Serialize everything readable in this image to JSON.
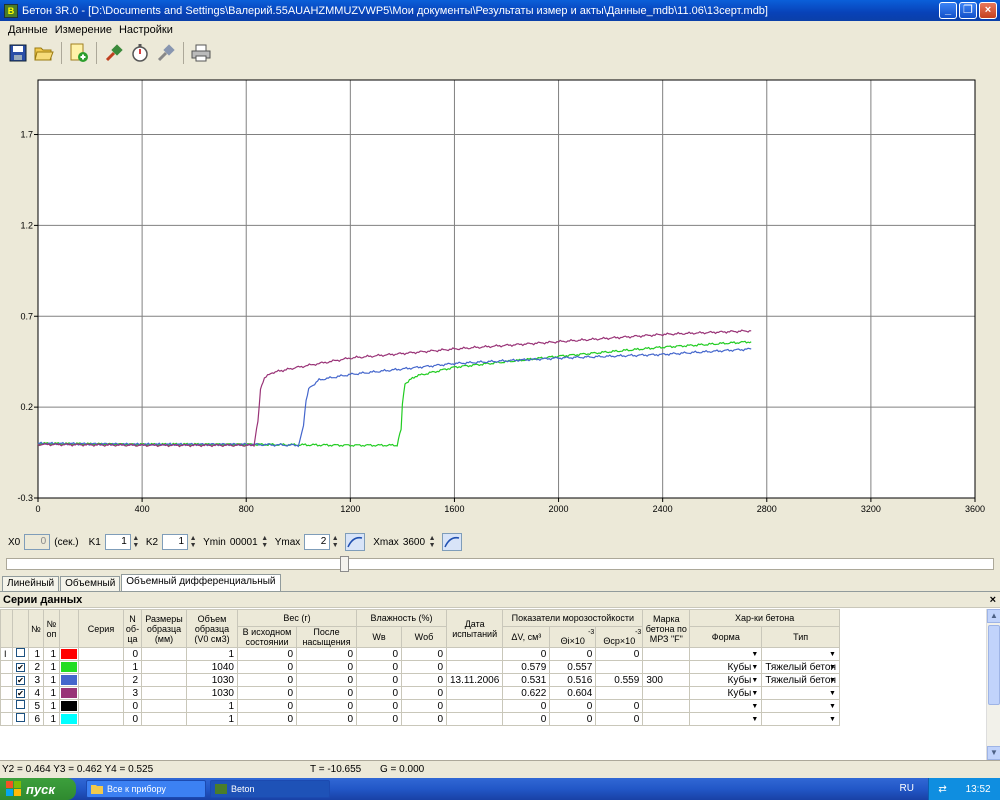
{
  "window": {
    "title": "Бетон 3R.0 - [D:\\Documents and Settings\\Валерий.55AUAHZMMUZVWP5\\Мои документы\\Результаты измер и акты\\Данные_mdb\\11.06\\13серт.mdb]",
    "app_icon_label": "B"
  },
  "menu": {
    "items": [
      "Данные",
      "Измерение",
      "Настройки"
    ]
  },
  "toolbar": {
    "icons": [
      "save-icon",
      "open-folder-icon",
      "add-document-icon",
      "connect-icon",
      "stopwatch-icon",
      "disconnect-icon",
      "print-icon"
    ]
  },
  "chart_data": {
    "type": "line",
    "title": "",
    "xlabel": "",
    "ylabel": "",
    "xlim": [
      0,
      3600
    ],
    "ylim": [
      -0.3,
      2.0
    ],
    "x_ticks": [
      "0",
      "400",
      "800",
      "1200",
      "1600",
      "2000",
      "2400",
      "2800",
      "3200",
      "3600"
    ],
    "y_ticks": [
      "-0.3",
      "0.2",
      "0.7",
      "1.2",
      "1.7"
    ],
    "grid": true,
    "series": [
      {
        "color": "#22cc22",
        "x": [
          0,
          400,
          800,
          1200,
          1380,
          1395,
          1400,
          1410,
          1450,
          1600,
          2000,
          2400,
          2740
        ],
        "y": [
          0.0,
          -0.005,
          -0.005,
          -0.01,
          -0.01,
          0.08,
          0.22,
          0.33,
          0.37,
          0.42,
          0.48,
          0.53,
          0.56
        ]
      },
      {
        "color": "#4466cc",
        "x": [
          0,
          400,
          800,
          1000,
          1020,
          1030,
          1040,
          1080,
          1200,
          1600,
          2000,
          2400,
          2740
        ],
        "y": [
          0.0,
          -0.005,
          -0.005,
          -0.01,
          0.1,
          0.24,
          0.3,
          0.35,
          0.38,
          0.44,
          0.47,
          0.49,
          0.52
        ]
      },
      {
        "color": "#993377",
        "x": [
          0,
          400,
          800,
          830,
          845,
          855,
          870,
          900,
          1000,
          1200,
          1600,
          2000,
          2400,
          2740
        ],
        "y": [
          -0.005,
          -0.01,
          -0.01,
          -0.01,
          0.12,
          0.3,
          0.36,
          0.39,
          0.42,
          0.47,
          0.52,
          0.56,
          0.6,
          0.62
        ]
      }
    ]
  },
  "controls": {
    "x0_label": "X0",
    "x0_value": "0",
    "x0_unit": "(сек.)",
    "k1_label": "K1",
    "k1_value": "1",
    "k2_label": "K2",
    "k2_value": "1",
    "ymin_label": "Ymin",
    "ymin_value": "00001",
    "ymax_label": "Ymax",
    "ymax_value": "2",
    "xmax_label": "Xmax",
    "xmax_value": "3600"
  },
  "slider": {
    "position": 0.34
  },
  "tabs": [
    "Линейный",
    "Объемный",
    "Объемный дифференциальный"
  ],
  "panel": {
    "title": "Серии данных",
    "close": "×"
  },
  "table": {
    "headers": {
      "num": "№",
      "num_op": "№ оп",
      "series": "Серия",
      "n_obr": "N об- ца",
      "size": "Размеры образца (мм)",
      "volume": "Объем образца (V0 см3)",
      "weight": "Вес (г)",
      "weight_init": "В исходном состоянии",
      "weight_sat": "После насыщения",
      "humidity": "Влажность (%)",
      "wv": "Wв",
      "wob": "Wоб",
      "date": "Дата испытаний",
      "frost": "Показатели морозостойкости",
      "dv": "ΔV, см³",
      "theta_i": "Θi×10",
      "theta_cp": "Θср×10",
      "exp": "-3",
      "brand": "Марка бетона по МРЗ \"F\"",
      "props": "Хар-ки бетона",
      "form": "Форма",
      "type": "Тип"
    },
    "rows": [
      {
        "checked": false,
        "num": "1",
        "op": "1",
        "color": "#ff0000",
        "nobr": "0",
        "size": "",
        "vol": "1",
        "w1": "0",
        "w2": "0",
        "wv": "0",
        "wob": "0",
        "date": "",
        "dv": "0",
        "ti": "0",
        "tcp": "0",
        "brand": "",
        "form": "",
        "type": ""
      },
      {
        "checked": true,
        "num": "2",
        "op": "1",
        "color": "#22dd22",
        "nobr": "1",
        "size": "",
        "vol": "1040",
        "w1": "0",
        "w2": "0",
        "wv": "0",
        "wob": "0",
        "date": "",
        "dv": "0.579",
        "ti": "0.557",
        "tcp": "",
        "brand": "",
        "form": "Кубы",
        "type": "Тяжелый бетон"
      },
      {
        "checked": true,
        "num": "3",
        "op": "1",
        "color": "#4466cc",
        "nobr": "2",
        "size": "",
        "vol": "1030",
        "w1": "0",
        "w2": "0",
        "wv": "0",
        "wob": "0",
        "date": "13.11.2006",
        "dv": "0.531",
        "ti": "0.516",
        "tcp": "0.559",
        "brand": "300",
        "form": "Кубы",
        "type": "Тяжелый бетон"
      },
      {
        "checked": true,
        "num": "4",
        "op": "1",
        "color": "#993377",
        "nobr": "3",
        "size": "",
        "vol": "1030",
        "w1": "0",
        "w2": "0",
        "wv": "0",
        "wob": "0",
        "date": "",
        "dv": "0.622",
        "ti": "0.604",
        "tcp": "",
        "brand": "",
        "form": "Кубы",
        "type": ""
      },
      {
        "checked": false,
        "num": "5",
        "op": "1",
        "color": "#000000",
        "nobr": "0",
        "size": "",
        "vol": "1",
        "w1": "0",
        "w2": "0",
        "wv": "0",
        "wob": "0",
        "date": "",
        "dv": "0",
        "ti": "0",
        "tcp": "0",
        "brand": "",
        "form": "",
        "type": ""
      },
      {
        "checked": false,
        "num": "6",
        "op": "1",
        "color": "#00ffff",
        "nobr": "0",
        "size": "",
        "vol": "1",
        "w1": "0",
        "w2": "0",
        "wv": "0",
        "wob": "0",
        "date": "",
        "dv": "0",
        "ti": "0",
        "tcp": "0",
        "brand": "",
        "form": "",
        "type": ""
      }
    ]
  },
  "status": {
    "left": "Y2 = 0.464 Y3 = 0.462 Y4 = 0.525",
    "t": "T = -10.655",
    "g": "G = 0.000"
  },
  "taskbar": {
    "start": "пуск",
    "tasks": [
      "Все к прибору",
      "Beton"
    ],
    "lang": "RU",
    "time": "13:52"
  }
}
